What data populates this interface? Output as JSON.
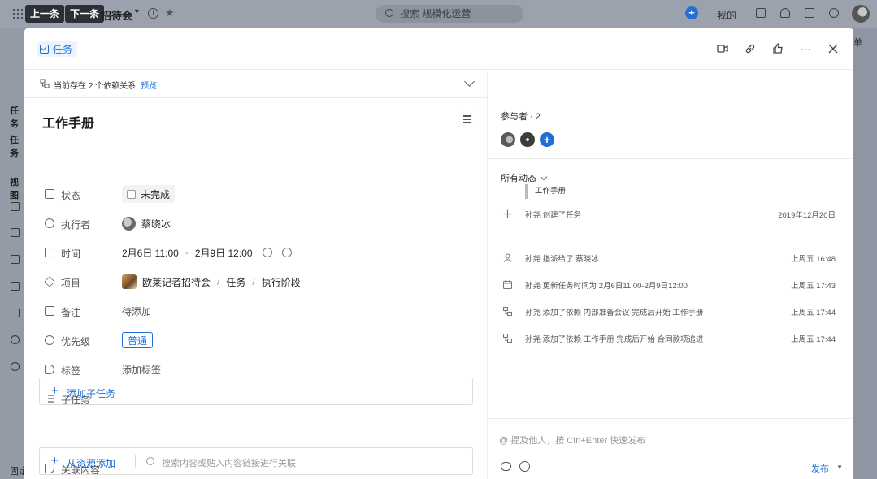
{
  "background": {
    "prev_label": "上一条",
    "next_label": "下一条",
    "project_title": "招待会",
    "search_placeholder": "搜索 规模化运营",
    "mine_label": "我的",
    "side_labels": [
      "任务",
      "任务",
      "视图"
    ],
    "bottom_label": "固定",
    "right_edge_text": "单"
  },
  "modal": {
    "type_label": "任务",
    "dependency": {
      "text": "当前存在 2 个依赖关系",
      "link": "预览"
    },
    "title": "工作手册",
    "fields": {
      "status": {
        "label": "状态",
        "value": "未完成"
      },
      "assignee": {
        "label": "执行者",
        "value": "蔡晓冰"
      },
      "time": {
        "label": "时间",
        "start": "2月6日 11:00",
        "separator": "-",
        "end": "2月9日 12:00"
      },
      "project": {
        "label": "项目",
        "name": "欧莱记者招待会",
        "group": "任务",
        "stage": "执行阶段",
        "separator": "/"
      },
      "note": {
        "label": "备注",
        "value": "待添加"
      },
      "priority": {
        "label": "优先级",
        "value": "普通"
      },
      "tags": {
        "label": "标签",
        "value": "添加标签"
      },
      "subtasks": {
        "label": "子任务",
        "add_label": "添加子任务"
      },
      "related": {
        "label": "关联内容",
        "add_label": "从资源添加",
        "search_placeholder": "搜索内容或贴入内容链接进行关联"
      }
    },
    "participants": {
      "title": "参与者 · 2"
    },
    "activity": {
      "filter_label": "所有动态",
      "items": [
        {
          "icon": "plus-icon",
          "text": "孙尧 创建了任务",
          "time": "2019年12月20日"
        },
        {
          "icon": "user-icon",
          "text": "孙尧 指派给了 蔡晓冰",
          "time": "上周五 16:48"
        },
        {
          "icon": "calendar-icon",
          "text": "孙尧 更新任务时间为 2月6日11:00-2月9日12:00",
          "time": "上周五 17:43"
        },
        {
          "icon": "dependency-icon",
          "text": "孙尧 添加了依赖 内部准备会议 完成后开始 工作手册",
          "time": "上周五 17:44"
        },
        {
          "icon": "dependency-icon",
          "text": "孙尧 添加了依赖 工作手册 完成后开始 合同款项追进",
          "time": "上周五 17:44"
        }
      ],
      "created_quote": "工作手册"
    },
    "comment": {
      "placeholder": "@ 提及他人，按 Ctrl+Enter 快速发布",
      "publish_label": "发布"
    }
  },
  "colors": {
    "accent": "#1f6fd6",
    "overlay": "#8f95a3"
  }
}
